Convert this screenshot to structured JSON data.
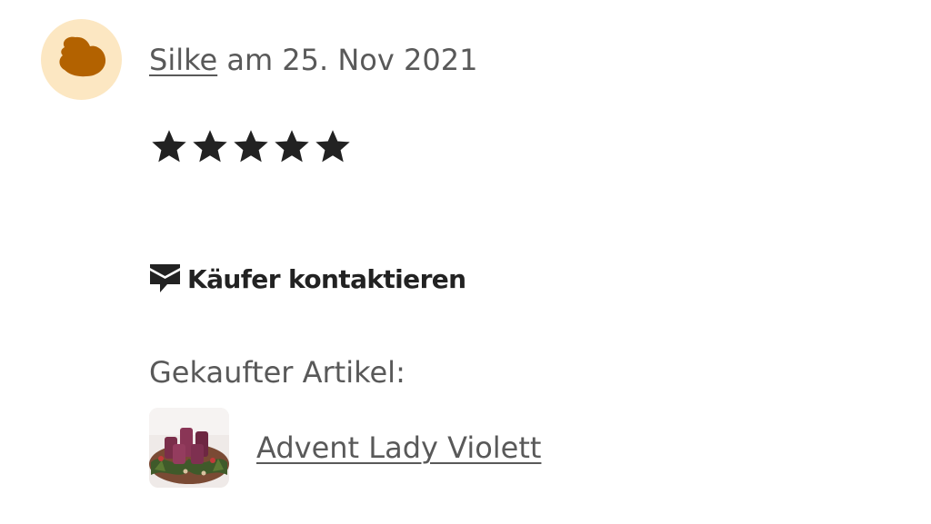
{
  "review": {
    "avatar_icon": "user-avatar-icon",
    "avatar_bg": "#fce7c2",
    "avatar_fg": "#b36200",
    "author": "Silke",
    "date_text": "am 25. Nov 2021",
    "rating": 5,
    "rating_max": 5,
    "star_icon": "star-icon",
    "star_color": "#222222"
  },
  "contact": {
    "icon": "message-icon",
    "label": "Käufer kontaktieren"
  },
  "purchased": {
    "label": "Gekaufter Artikel:",
    "item_name": "Advent Lady Violett",
    "thumbnail_icon": "product-thumbnail"
  }
}
